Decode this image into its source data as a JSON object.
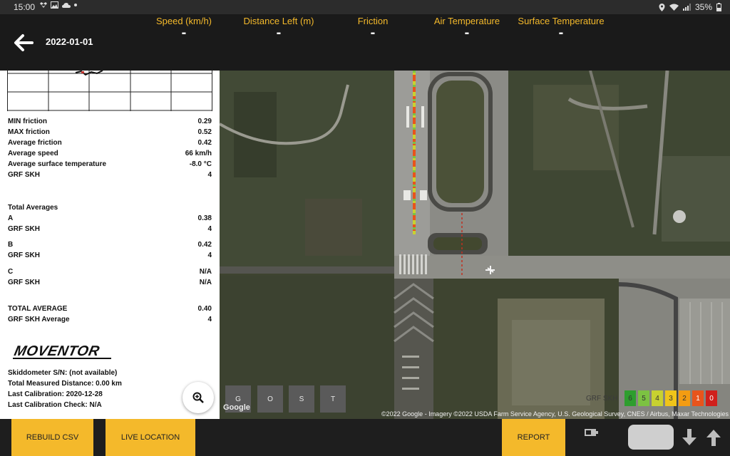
{
  "status_bar": {
    "time": "15:00",
    "battery": "35%"
  },
  "header": {
    "date": "2022-01-01",
    "metrics": [
      {
        "label": "Speed (km/h)",
        "value": "-"
      },
      {
        "label": "Distance Left (m)",
        "value": "-"
      },
      {
        "label": "Friction",
        "value": "-"
      },
      {
        "label": "Air Temperature",
        "value": "-"
      },
      {
        "label": "Surface Temperature",
        "value": "-"
      }
    ]
  },
  "stats": [
    {
      "label": "MIN friction",
      "value": "0.29"
    },
    {
      "label": "MAX friction",
      "value": "0.52"
    },
    {
      "label": "Average friction",
      "value": "0.42"
    },
    {
      "label": "Average speed",
      "value": "66 km/h"
    },
    {
      "label": "Average surface temperature",
      "value": "-8.0 °C"
    },
    {
      "label": "GRF SKH",
      "value": "4"
    }
  ],
  "totals": {
    "title": "Total Averages",
    "items": [
      {
        "label": "A",
        "value": "0.38"
      },
      {
        "label": "GRF SKH",
        "value": "4"
      },
      {
        "label": "B",
        "value": "0.42"
      },
      {
        "label": "GRF SKH",
        "value": "4"
      },
      {
        "label": "C",
        "value": "N/A"
      },
      {
        "label": "GRF SKH",
        "value": "N/A"
      },
      {
        "label": "TOTAL AVERAGE",
        "value": "0.40"
      },
      {
        "label": "GRF SKH Average",
        "value": "4"
      }
    ]
  },
  "brand": "MOVENTOR",
  "device_info": [
    "Skiddometer S/N: (not available)",
    "Total Measured Distance: 0.00 km",
    "Last Calibration: 2020-12-28",
    "Last Calibration Check: N/A"
  ],
  "map": {
    "layer_buttons": [
      "G",
      "O",
      "S",
      "T"
    ],
    "legend_label": "GRF SKH",
    "legend": [
      {
        "label": "6",
        "color": "#2e9e2e"
      },
      {
        "label": "5",
        "color": "#7cc242"
      },
      {
        "label": "4",
        "color": "#c8d130"
      },
      {
        "label": "3",
        "color": "#f0c419"
      },
      {
        "label": "2",
        "color": "#f39c12"
      },
      {
        "label": "1",
        "color": "#e8541c"
      },
      {
        "label": "0",
        "color": "#d0201c"
      }
    ],
    "attribution": "©2022 Google - Imagery ©2022 USDA Farm Service Agency, U.S. Geological Survey, CNES / Airbus, Maxar Technologies",
    "google_mark": "Google"
  },
  "bottom_bar": {
    "rebuild_csv": "REBUILD CSV",
    "live_location": "LIVE LOCATION",
    "report": "REPORT"
  },
  "colors": {
    "accent": "#f4b92b"
  }
}
